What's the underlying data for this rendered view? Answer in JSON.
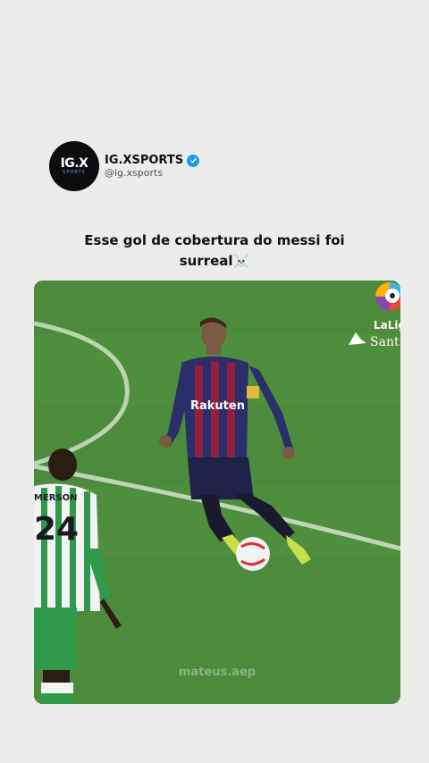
{
  "post": {
    "author": {
      "display_name": "IG.XSPORTS",
      "handle": "@lg.xsports",
      "avatar_text": "IG.X",
      "avatar_subtext": "SPORTS",
      "verified": true
    },
    "caption_line1": "Esse gol de cobertura do messi foi",
    "caption_line2": "surreal",
    "caption_emoji": "☠️"
  },
  "media": {
    "watermark": "mateus.aep",
    "league_text": "LaLig",
    "sponsor_text": "Sant",
    "player_shirt_sponsor": "Rakuten",
    "opponent_shirt_name": "MERSON",
    "opponent_shirt_number": "24"
  },
  "colors": {
    "background": "#ececea",
    "pitch": "#4b8a3a",
    "verified": "#1d9bf0"
  }
}
